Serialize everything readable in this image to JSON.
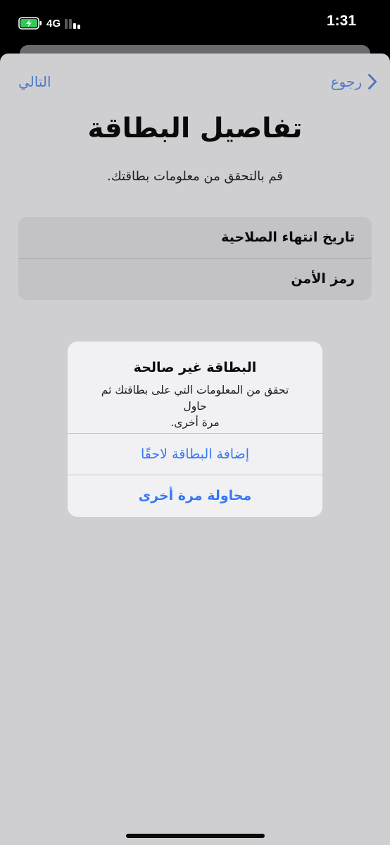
{
  "status_bar": {
    "network": "4G",
    "time": "1:31",
    "battery_icon": "battery-charging-icon",
    "signal_icon": "cellular-signal-icon"
  },
  "nav": {
    "back_label": "رجوع",
    "next_label": "التالي",
    "back_icon": "chevron-right-icon"
  },
  "page": {
    "title": "تفاصيل البطاقة",
    "subtitle": "قم بالتحقق من معلومات بطاقتك."
  },
  "form": {
    "fields": [
      {
        "label": "تاريخ انتهاء الصلاحية"
      },
      {
        "label": "رمز الأمن"
      }
    ]
  },
  "alert": {
    "title": "البطاقة غير صالحة",
    "message_line1": "تحقق من المعلومات التي على بطاقتك ثم حاول",
    "message_line2": "مرة أخرى.",
    "actions": [
      {
        "label": "إضافة البطاقة لاحقًا"
      },
      {
        "label": "محاولة مرة أخرى"
      }
    ]
  },
  "colors": {
    "accent": "#3478f6",
    "battery_green": "#34c759",
    "sheet_background": "#cfcfd2",
    "alert_background": "#f1f1f3"
  }
}
